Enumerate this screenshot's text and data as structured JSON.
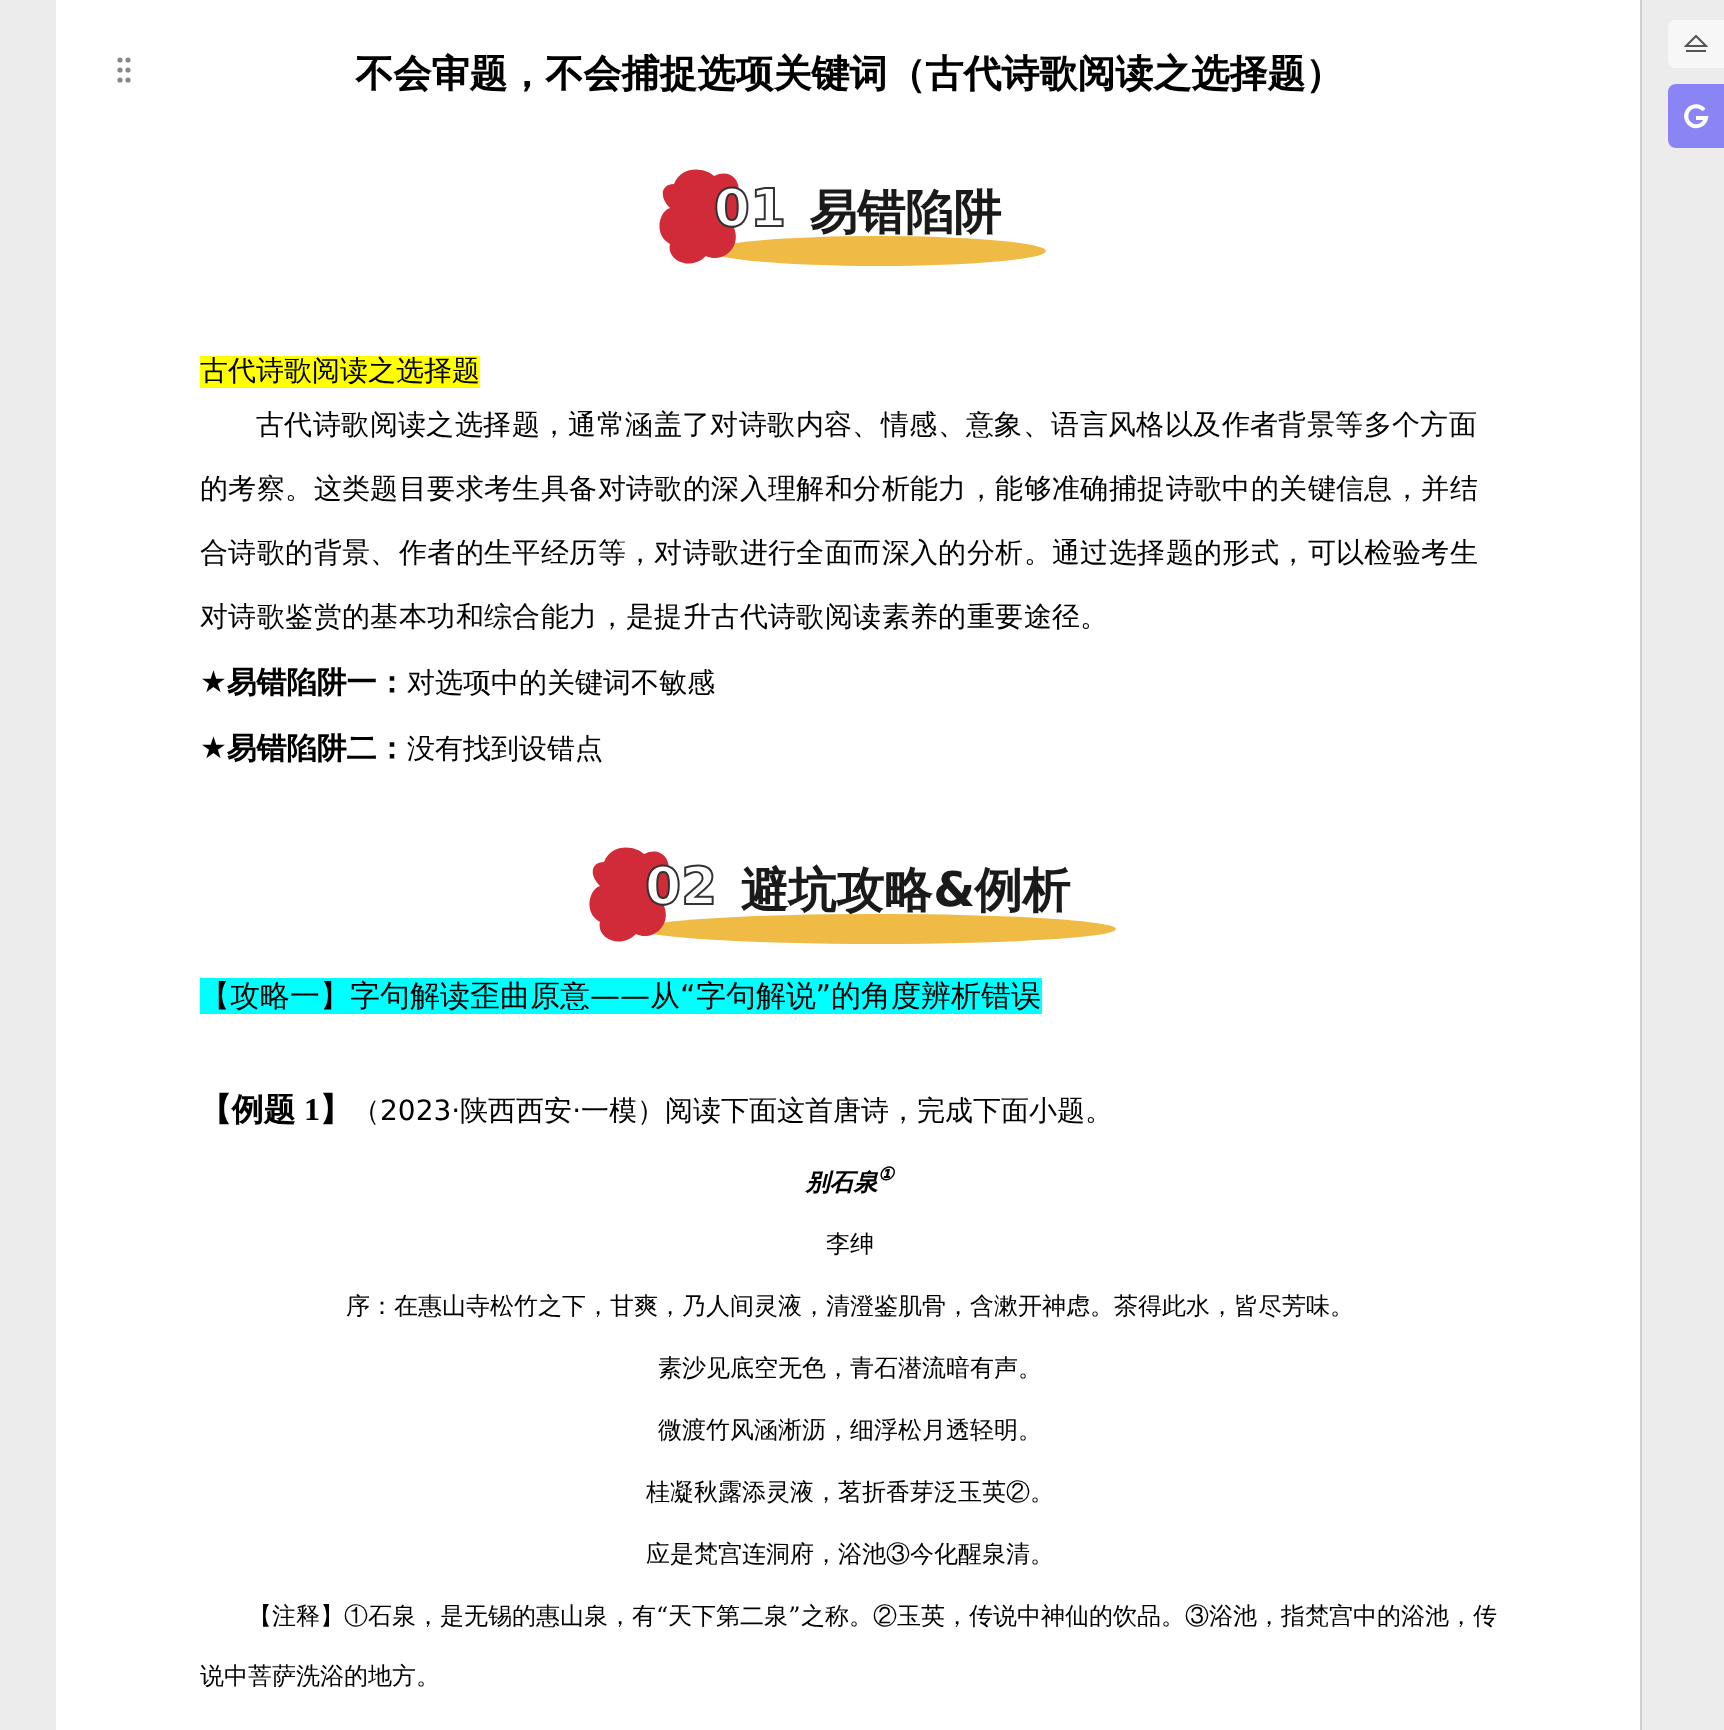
{
  "document": {
    "title": "不会审题，不会捕捉选项关键词（古代诗歌阅读之选择题）",
    "banner_1": {
      "number": "01",
      "label": "易错陷阱"
    },
    "subheading": "古代诗歌阅读之选择题",
    "intro": "古代诗歌阅读之选择题，通常涵盖了对诗歌内容、情感、意象、语言风格以及作者背景等多个方面的考察。这类题目要求考生具备对诗歌的深入理解和分析能力，能够准确捕捉诗歌中的关键信息，并结合诗歌的背景、作者的生平经历等，对诗歌进行全面而深入的分析。通过选择题的形式，可以检验考生对诗歌鉴赏的基本功和综合能力，是提升古代诗歌阅读素养的重要途径。",
    "traps": [
      {
        "label": "★易错陷阱一：",
        "text": "对选项中的关键词不敏感"
      },
      {
        "label": "★易错陷阱二：",
        "text": "没有找到设错点"
      }
    ],
    "banner_2": {
      "number": "02",
      "label": "避坑攻略&例析"
    },
    "strategy": "【攻略一】字句解读歪曲原意——从“字句解说”的角度辨析错误",
    "example": {
      "label": "【例题 1】",
      "text": "（2023·陕西西安·一模）阅读下面这首唐诗，完成下面小题。"
    },
    "poem": {
      "title": "别石泉$^{①}$",
      "author": "李绅",
      "lines": [
        "序：在惠山寺松竹之下，甘爽，乃人间灵液，清澄鉴肌骨，含漱开神虑。茶得此水，皆尽芳味。",
        "素沙见底空无色，青石潜流暗有声。",
        "微渡竹风涵淅沥，细浮松月透轻明。",
        "桂凝秋露添灵液，茗折香芽泛玉英②。",
        "应是梵宫连洞府，浴池③今化醒泉清。"
      ]
    },
    "note": "【注释】①石泉，是无锡的惠山泉，有“天下第二泉”之称。②玉英，传说中神仙的饮品。③浴池，指梵宫中的浴池，传说中菩萨洗浴的地方。"
  }
}
